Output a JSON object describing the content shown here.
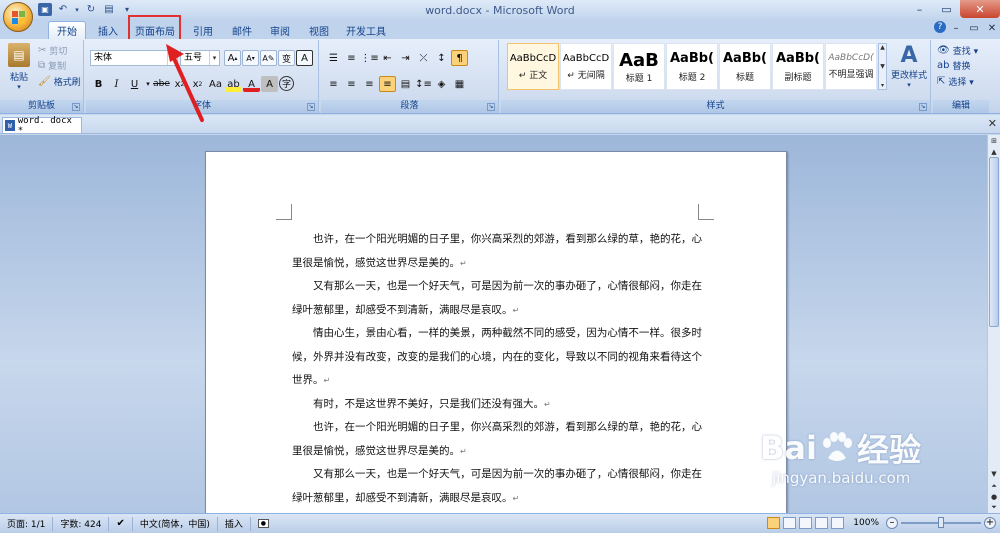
{
  "titlebar": {
    "title": "word.docx - Microsoft Word",
    "controls": [
      "–",
      "▭",
      "✕"
    ]
  },
  "tabs": [
    {
      "label": "开始"
    },
    {
      "label": "插入"
    },
    {
      "label": "页面布局"
    },
    {
      "label": "引用"
    },
    {
      "label": "邮件"
    },
    {
      "label": "审阅"
    },
    {
      "label": "视图"
    },
    {
      "label": "开发工具"
    }
  ],
  "ribbon": {
    "clipboard": {
      "paste": "粘贴",
      "cut": "剪切",
      "copy": "复制",
      "format_painter": "格式刷",
      "label": "剪贴板"
    },
    "font": {
      "name": "宋体",
      "size": "五号",
      "label": "字体"
    },
    "paragraph": {
      "label": "段落"
    },
    "styles": {
      "label": "样式",
      "change_styles": "更改样式",
      "items": [
        {
          "sample": "AaBbCcD",
          "name": "↵ 正文"
        },
        {
          "sample": "AaBbCcD",
          "name": "↵ 无间隔"
        },
        {
          "sample": "AaB",
          "name": "标题 1"
        },
        {
          "sample": "AaBb(",
          "name": "标题 2"
        },
        {
          "sample": "AaBb(",
          "name": "标题"
        },
        {
          "sample": "AaBb(",
          "name": "副标题"
        },
        {
          "sample": "AaBbCcD(",
          "name": "不明显强调"
        }
      ]
    },
    "editing": {
      "find": "查找 ▾",
      "replace": "替换",
      "select": "选择 ▾",
      "label": "编辑"
    }
  },
  "document_tab": {
    "name": "word. docx *"
  },
  "document": {
    "paragraphs": [
      "也许，在一个阳光明媚的日子里，你兴高采烈的郊游，看到那么绿的草，艳的花，心里很是愉悦，感觉这世界尽是美的。",
      "又有那么一天，也是一个好天气，可是因为前一次的事办砸了，心情很郁闷，你走在绿叶葱郁里，却感受不到清新，满眼尽是哀叹。",
      "情由心生，景由心看，一样的美景，两种截然不同的感受，因为心情不一样。很多时候，外界并没有改变，改变的是我们的心境，内在的变化，导致以不同的视角来看待这个世界。",
      "有时，不是这世界不美好，只是我们还没有强大。",
      "也许，在一个阳光明媚的日子里，你兴高采烈的郊游，看到那么绿的草，艳的花，心里很是愉悦，感觉这世界尽是美的。",
      "又有那么一天，也是一个好天气，可是因为前一次的事办砸了，心情很郁闷，你走在绿叶葱郁里，却感受不到清新，满眼尽是哀叹。"
    ],
    "paragraph_mark": "↵"
  },
  "statusbar": {
    "page": "页面: 1/1",
    "words": "字数: 424",
    "language": "中文(简体，中国)",
    "mode": "插入",
    "zoom": "100%"
  },
  "watermark": {
    "brand": "Bai",
    "brand_suffix": "经验",
    "url": "jingyan.baidu.com"
  },
  "colors": {
    "highlight_box": "#e03030",
    "accent": "#15428b"
  }
}
